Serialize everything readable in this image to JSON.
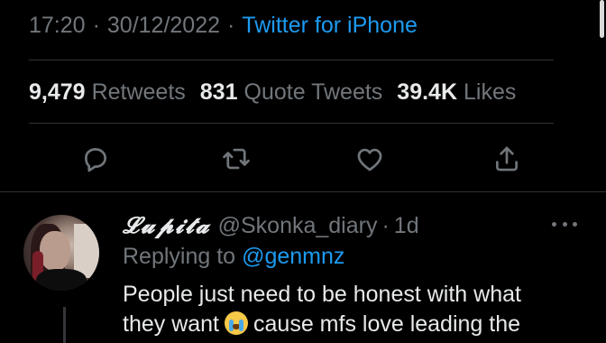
{
  "tweet_meta": {
    "time": "17:20",
    "separator": "·",
    "date": "30/12/2022",
    "source": "Twitter for iPhone"
  },
  "stats": {
    "retweets_count": "9,479",
    "retweets_label": "Retweets",
    "quote_count": "831",
    "quote_label": "Quote Tweets",
    "likes_count": "39.4K",
    "likes_label": "Likes"
  },
  "actions": {
    "reply_icon": "reply-icon",
    "retweet_icon": "retweet-icon",
    "like_icon": "heart-icon",
    "share_icon": "share-icon"
  },
  "reply": {
    "display_name": "𝓛𝓾𝓹𝓲𝓽𝓪",
    "handle": "@Skonka_diary",
    "separator": "·",
    "time": "1d",
    "replying_to_label": "Replying to",
    "replying_to_mention": "@genmnz",
    "text_line1": "People just need to be honest with what",
    "text_line2_before": "they want",
    "emoji_name": "loudly-crying-face",
    "text_line2_after": "cause mfs love leading the"
  },
  "colors": {
    "background": "#000000",
    "primary_text": "#e7e9ea",
    "secondary_text": "#71767b",
    "accent": "#1d9bf0",
    "divider": "#2f3336"
  }
}
